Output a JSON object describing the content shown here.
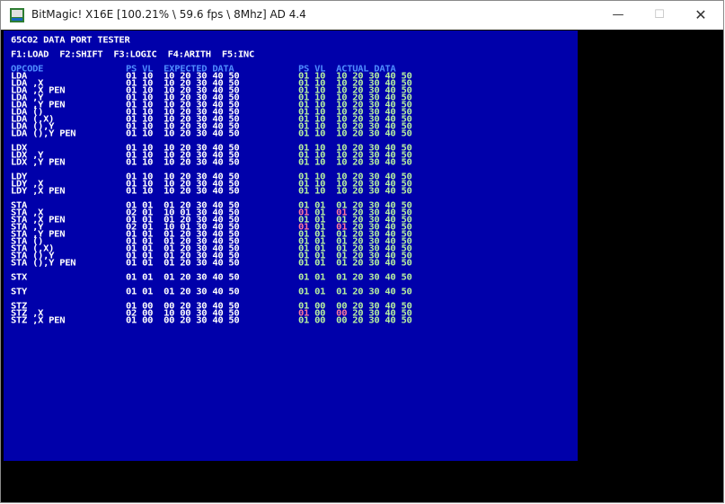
{
  "window": {
    "title": "BitMagic! X16E [100.21% \\ 59.6 fps \\ 8Mhz] AD 4.4",
    "min_icon": "minimize-icon",
    "max_icon": "maximize-icon",
    "close_icon": "close-icon"
  },
  "screen": {
    "header": "65C02 DATA PORT TESTER",
    "menu": "F1:LOAD  F2:SHIFT  F3:LOGIC  F4:ARITH  F5:INC",
    "col_opcode": "OPCODE",
    "col_expected": "PS VL  EXPECTED DATA",
    "col_actual": "PS VL  ACTUAL DATA",
    "colors": {
      "background": "#0000aa",
      "text": "#ffffff",
      "header": "#4f8dff",
      "ok": "#b7f0a0",
      "mismatch": "#ff7a9e"
    },
    "rows": [
      {
        "op": "LDA",
        "exp": "01 10  10 20 30 40 50",
        "ps": "01",
        "vl": "10",
        "act1": "10",
        "rest": "20 30 40 50",
        "err": false
      },
      {
        "op": "LDA ,X",
        "exp": "01 10  10 20 30 40 50",
        "ps": "01",
        "vl": "10",
        "act1": "10",
        "rest": "20 30 40 50",
        "err": false
      },
      {
        "op": "LDA ,X PEN",
        "exp": "01 10  10 20 30 40 50",
        "ps": "01",
        "vl": "10",
        "act1": "10",
        "rest": "20 30 40 50",
        "err": false
      },
      {
        "op": "LDA ,Y",
        "exp": "01 10  10 20 30 40 50",
        "ps": "01",
        "vl": "10",
        "act1": "10",
        "rest": "20 30 40 50",
        "err": false
      },
      {
        "op": "LDA ,Y PEN",
        "exp": "01 10  10 20 30 40 50",
        "ps": "01",
        "vl": "10",
        "act1": "10",
        "rest": "20 30 40 50",
        "err": false
      },
      {
        "op": "LDA ()",
        "exp": "01 10  10 20 30 40 50",
        "ps": "01",
        "vl": "10",
        "act1": "10",
        "rest": "20 30 40 50",
        "err": false
      },
      {
        "op": "LDA (,X)",
        "exp": "01 10  10 20 30 40 50",
        "ps": "01",
        "vl": "10",
        "act1": "10",
        "rest": "20 30 40 50",
        "err": false
      },
      {
        "op": "LDA (),Y",
        "exp": "01 10  10 20 30 40 50",
        "ps": "01",
        "vl": "10",
        "act1": "10",
        "rest": "20 30 40 50",
        "err": false
      },
      {
        "op": "LDA (),Y PEN",
        "exp": "01 10  10 20 30 40 50",
        "ps": "01",
        "vl": "10",
        "act1": "10",
        "rest": "20 30 40 50",
        "err": false
      },
      {
        "op": "LDX",
        "exp": "01 10  10 20 30 40 50",
        "ps": "01",
        "vl": "10",
        "act1": "10",
        "rest": "20 30 40 50",
        "err": false
      },
      {
        "op": "LDX ,Y",
        "exp": "01 10  10 20 30 40 50",
        "ps": "01",
        "vl": "10",
        "act1": "10",
        "rest": "20 30 40 50",
        "err": false
      },
      {
        "op": "LDX ,Y PEN",
        "exp": "01 10  10 20 30 40 50",
        "ps": "01",
        "vl": "10",
        "act1": "10",
        "rest": "20 30 40 50",
        "err": false
      },
      {
        "op": "LDY",
        "exp": "01 10  10 20 30 40 50",
        "ps": "01",
        "vl": "10",
        "act1": "10",
        "rest": "20 30 40 50",
        "err": false
      },
      {
        "op": "LDY ,X",
        "exp": "01 10  10 20 30 40 50",
        "ps": "01",
        "vl": "10",
        "act1": "10",
        "rest": "20 30 40 50",
        "err": false
      },
      {
        "op": "LDY ,X PEN",
        "exp": "01 10  10 20 30 40 50",
        "ps": "01",
        "vl": "10",
        "act1": "10",
        "rest": "20 30 40 50",
        "err": false
      },
      {
        "op": "STA",
        "exp": "01 01  01 20 30 40 50",
        "ps": "01",
        "vl": "01",
        "act1": "01",
        "rest": "20 30 40 50",
        "err": false
      },
      {
        "op": "STA ,X",
        "exp": "02 01  10 01 30 40 50",
        "ps": "01",
        "vl": "01",
        "act1": "01",
        "rest": "20 30 40 50",
        "err": true
      },
      {
        "op": "STA ,X PEN",
        "exp": "01 01  01 20 30 40 50",
        "ps": "01",
        "vl": "01",
        "act1": "01",
        "rest": "20 30 40 50",
        "err": false
      },
      {
        "op": "STA ,Y",
        "exp": "02 01  10 01 30 40 50",
        "ps": "01",
        "vl": "01",
        "act1": "01",
        "rest": "20 30 40 50",
        "err": true
      },
      {
        "op": "STA ,Y PEN",
        "exp": "01 01  01 20 30 40 50",
        "ps": "01",
        "vl": "01",
        "act1": "01",
        "rest": "20 30 40 50",
        "err": false
      },
      {
        "op": "STA ()",
        "exp": "01 01  01 20 30 40 50",
        "ps": "01",
        "vl": "01",
        "act1": "01",
        "rest": "20 30 40 50",
        "err": false
      },
      {
        "op": "STA (,X)",
        "exp": "01 01  01 20 30 40 50",
        "ps": "01",
        "vl": "01",
        "act1": "01",
        "rest": "20 30 40 50",
        "err": false
      },
      {
        "op": "STA (),Y",
        "exp": "01 01  01 20 30 40 50",
        "ps": "01",
        "vl": "01",
        "act1": "01",
        "rest": "20 30 40 50",
        "err": false
      },
      {
        "op": "STA (),Y PEN",
        "exp": "01 01  01 20 30 40 50",
        "ps": "01",
        "vl": "01",
        "act1": "01",
        "rest": "20 30 40 50",
        "err": false
      },
      {
        "op": "STX",
        "exp": "01 01  01 20 30 40 50",
        "ps": "01",
        "vl": "01",
        "act1": "01",
        "rest": "20 30 40 50",
        "err": false
      },
      {
        "op": "STY",
        "exp": "01 01  01 20 30 40 50",
        "ps": "01",
        "vl": "01",
        "act1": "01",
        "rest": "20 30 40 50",
        "err": false
      },
      {
        "op": "STZ",
        "exp": "01 00  00 20 30 40 50",
        "ps": "01",
        "vl": "00",
        "act1": "00",
        "rest": "20 30 40 50",
        "err": false
      },
      {
        "op": "STZ ,X",
        "exp": "02 00  10 00 30 40 50",
        "ps": "01",
        "vl": "00",
        "act1": "00",
        "rest": "20 30 40 50",
        "err": true
      },
      {
        "op": "STZ ,X PEN",
        "exp": "01 00  00 20 30 40 50",
        "ps": "01",
        "vl": "00",
        "act1": "00",
        "rest": "20 30 40 50",
        "err": false
      }
    ]
  }
}
